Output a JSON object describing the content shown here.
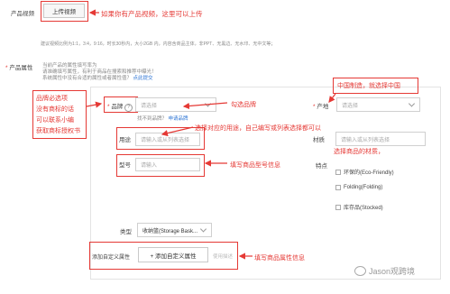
{
  "video": {
    "label": "产品视频",
    "upload_button": "上传视频",
    "hint": "建议视频比例为1:1，3:4，9:16，时长30秒内，大小2GB 内，内容含商品主体，非PPT、无黑边、无水印、无中文等；",
    "annotation": "如果你有产品视频，这里可以上传"
  },
  "attributes": {
    "label": "产品属性",
    "notes": [
      "当前产品的属性填写率为",
      "请准确填写属性，有利于商品在搜索和推荐中曝光！",
      "系统属性中没有合适的属性或者属性值？"
    ],
    "notes_link": "点此提交",
    "brand": {
      "label": "品牌",
      "placeholder": "请选择",
      "not_found": "找不到品牌？",
      "apply_link": "申请品牌",
      "annotation_left": [
        "品牌必选项",
        "没有商标的话",
        "可以联系小编",
        "获取商标授权书"
      ],
      "annotation": "勾选品牌"
    },
    "origin": {
      "label": "产地",
      "placeholder": "请选择",
      "annotation": "中国制造，就选择中国"
    },
    "usage": {
      "label": "用途",
      "placeholder": "请输入或从列表选择",
      "annotation": "选择对应的用途，自己编写或列表选择都可以"
    },
    "material": {
      "label": "材质",
      "placeholder": "请输入或从列表选择",
      "annotation": "选择商品的材质，"
    },
    "model": {
      "label": "型号",
      "placeholder": "请输入",
      "annotation": "填写商品型号信息"
    },
    "features": {
      "label": "特点",
      "options": [
        "环保的(Eco-Friendly)",
        "Folding(Folding)",
        "库存品(Stocked)"
      ]
    },
    "type": {
      "label": "类型",
      "value": "收纳篮(Storage Bask..."
    },
    "custom": {
      "label": "添加自定义属性",
      "button": "+ 添加自定义属性",
      "tail": "使用描述",
      "annotation": "填写商品属性信息"
    }
  },
  "watermark": "Jason观跨境",
  "colors": {
    "annotation": "#e53935",
    "link": "#2d74d4"
  }
}
